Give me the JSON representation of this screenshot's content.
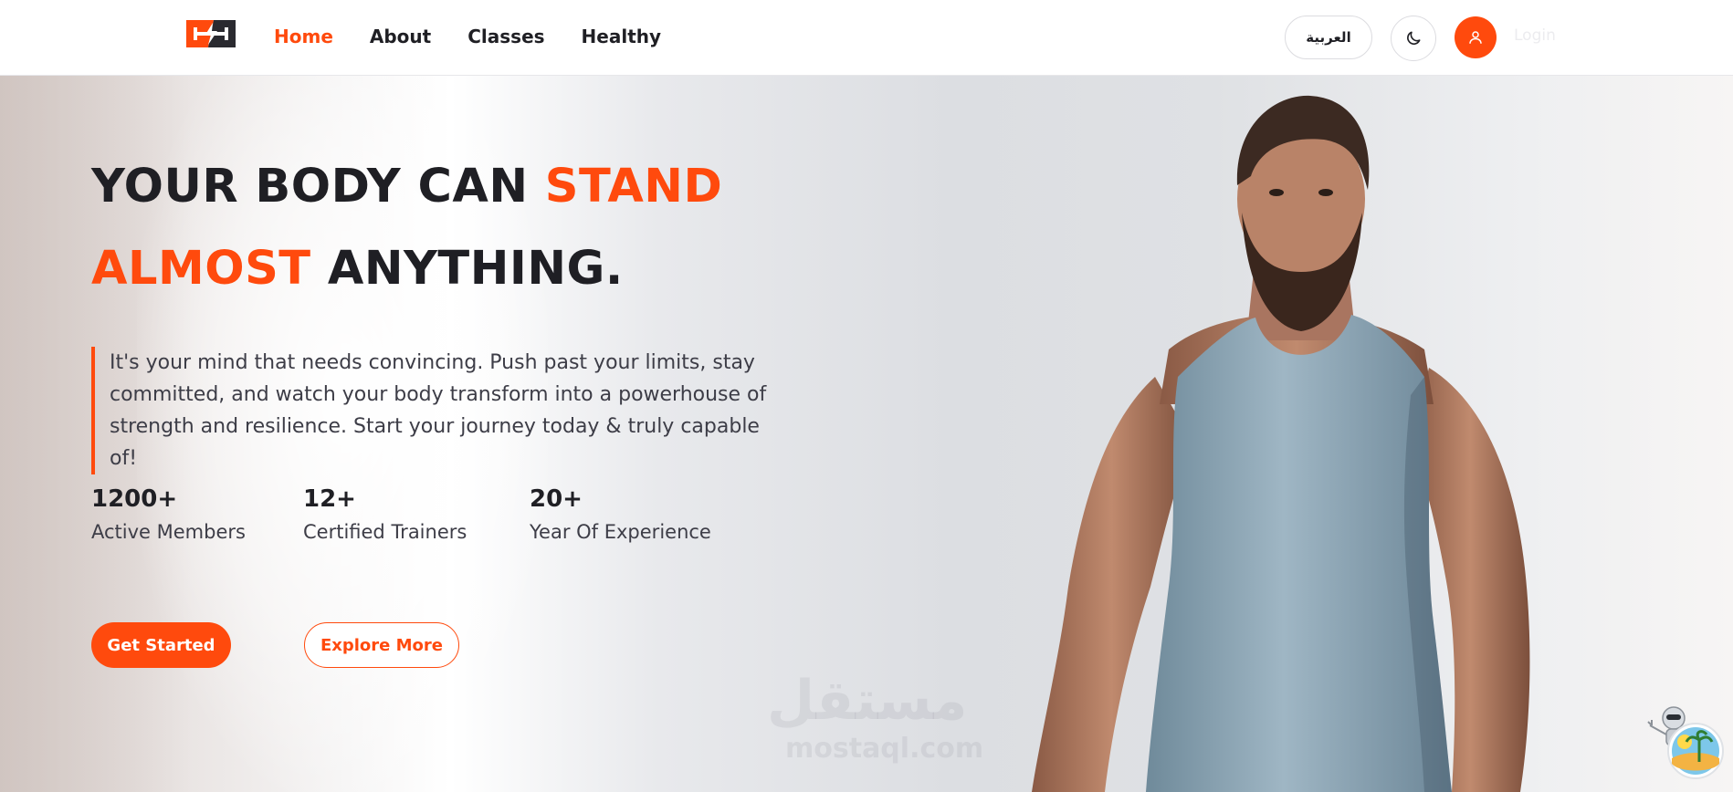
{
  "nav": {
    "links": [
      {
        "label": "Home",
        "active": true
      },
      {
        "label": "About",
        "active": false
      },
      {
        "label": "Classes",
        "active": false
      },
      {
        "label": "Healthy",
        "active": false
      }
    ],
    "language_button": "العربية",
    "theme_icon": "moon-icon",
    "user_icon": "user-icon",
    "login_label": "Login"
  },
  "hero": {
    "headline_part1": "YOUR BODY CAN ",
    "headline_accent1": "STAND",
    "headline_accent2": "ALMOST",
    "headline_part2": " ANYTHING.",
    "description": "It's your mind that needs convincing. Push past your limits, stay committed, and watch your body transform into a powerhouse of strength and resilience. Start your journey today & truly capable of!",
    "stats": [
      {
        "value": "1200+",
        "label": "Active Members"
      },
      {
        "value": "12+",
        "label": "Certified Trainers"
      },
      {
        "value": "20+",
        "label": "Year Of Experience"
      }
    ],
    "primary_button": "Get Started",
    "secondary_button": "Explore More"
  },
  "watermark": {
    "arabic": "مستقل",
    "latin": "mostaql.com"
  },
  "colors": {
    "accent": "#ff4a0d",
    "text": "#1f1f24"
  }
}
